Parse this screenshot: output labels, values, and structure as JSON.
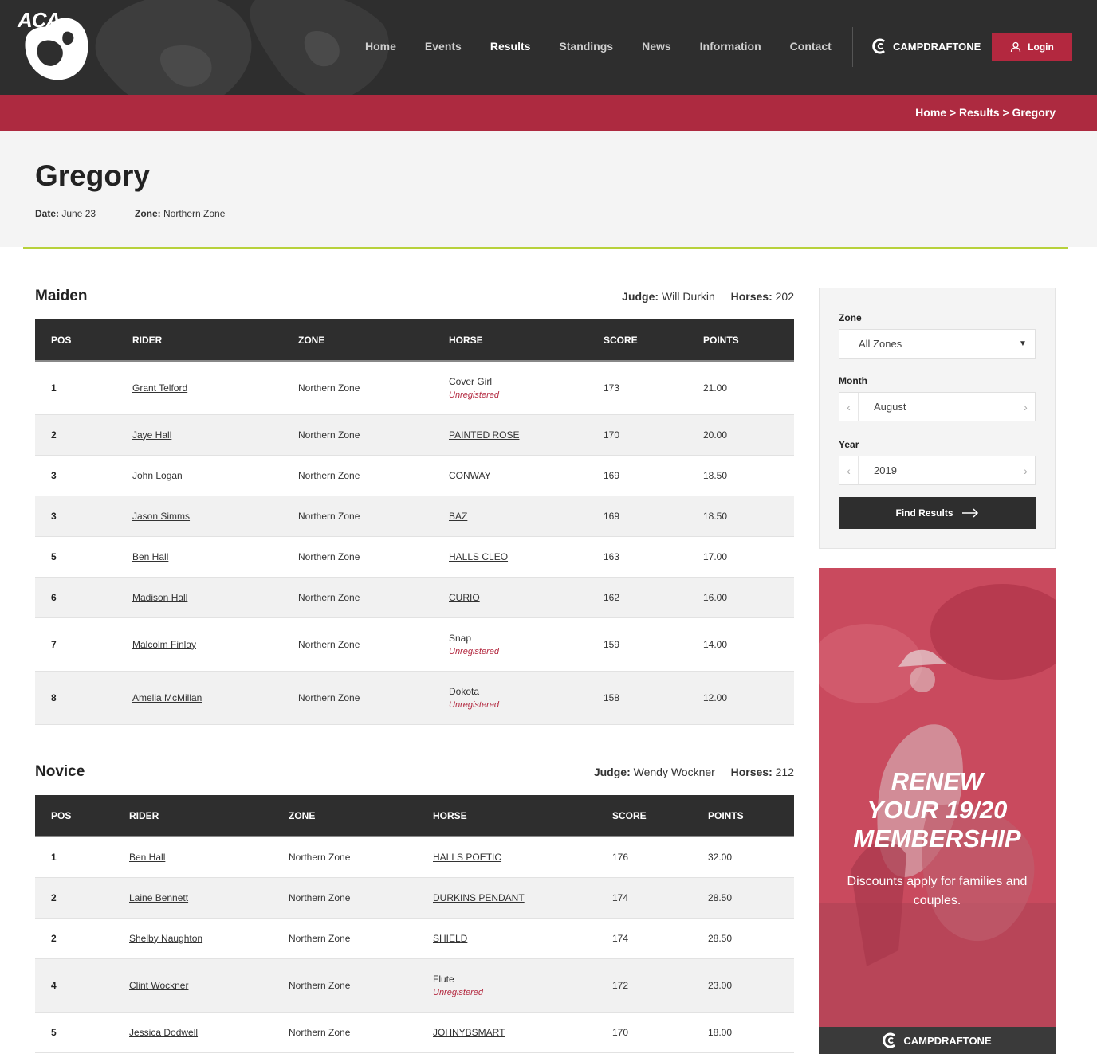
{
  "header": {
    "logo_text": "ACA",
    "nav": [
      {
        "label": "Home",
        "active": false
      },
      {
        "label": "Events",
        "active": false
      },
      {
        "label": "Results",
        "active": true
      },
      {
        "label": "Standings",
        "active": false
      },
      {
        "label": "News",
        "active": false
      },
      {
        "label": "Information",
        "active": false
      },
      {
        "label": "Contact",
        "active": false
      }
    ],
    "brand": "CAMPDRAFTONE",
    "login_label": "Login"
  },
  "breadcrumb": "Home > Results > Gregory",
  "page": {
    "title": "Gregory",
    "date_label": "Date:",
    "date_value": "June 23",
    "zone_label": "Zone:",
    "zone_value": "Northern Zone"
  },
  "sections": [
    {
      "title": "Maiden",
      "judge_label": "Judge:",
      "judge": "Will Durkin",
      "horses_label": "Horses:",
      "horses": "202",
      "columns": [
        "POS",
        "RIDER",
        "ZONE",
        "HORSE",
        "SCORE",
        "POINTS"
      ],
      "rows": [
        {
          "pos": "1",
          "rider": "Grant Telford",
          "zone": "Northern Zone",
          "horse": "Cover Girl",
          "unregistered": "Unregistered",
          "score": "173",
          "points": "21.00"
        },
        {
          "pos": "2",
          "rider": "Jaye Hall",
          "zone": "Northern Zone",
          "horse": "PAINTED ROSE",
          "score": "170",
          "points": "20.00"
        },
        {
          "pos": "3",
          "rider": "John Logan",
          "zone": "Northern Zone",
          "horse": "CONWAY",
          "score": "169",
          "points": "18.50"
        },
        {
          "pos": "3",
          "rider": "Jason Simms",
          "zone": "Northern Zone",
          "horse": "BAZ",
          "score": "169",
          "points": "18.50"
        },
        {
          "pos": "5",
          "rider": "Ben Hall",
          "zone": "Northern Zone",
          "horse": "HALLS CLEO",
          "score": "163",
          "points": "17.00"
        },
        {
          "pos": "6",
          "rider": "Madison Hall",
          "zone": "Northern Zone",
          "horse": "CURIO",
          "score": "162",
          "points": "16.00"
        },
        {
          "pos": "7",
          "rider": "Malcolm Finlay",
          "zone": "Northern Zone",
          "horse": "Snap",
          "unregistered": "Unregistered",
          "score": "159",
          "points": "14.00"
        },
        {
          "pos": "8",
          "rider": "Amelia McMillan",
          "zone": "Northern Zone",
          "horse": "Dokota",
          "unregistered": "Unregistered",
          "score": "158",
          "points": "12.00"
        }
      ]
    },
    {
      "title": "Novice",
      "judge_label": "Judge:",
      "judge": "Wendy Wockner",
      "horses_label": "Horses:",
      "horses": "212",
      "columns": [
        "POS",
        "RIDER",
        "ZONE",
        "HORSE",
        "SCORE",
        "POINTS"
      ],
      "rows": [
        {
          "pos": "1",
          "rider": "Ben Hall",
          "zone": "Northern Zone",
          "horse": "HALLS POETIC",
          "score": "176",
          "points": "32.00"
        },
        {
          "pos": "2",
          "rider": "Laine Bennett",
          "zone": "Northern Zone",
          "horse": "DURKINS PENDANT",
          "score": "174",
          "points": "28.50"
        },
        {
          "pos": "2",
          "rider": "Shelby Naughton",
          "zone": "Northern Zone",
          "horse": "SHIELD",
          "score": "174",
          "points": "28.50"
        },
        {
          "pos": "4",
          "rider": "Clint Wockner",
          "zone": "Northern Zone",
          "horse": "Flute",
          "unregistered": "Unregistered",
          "score": "172",
          "points": "23.00"
        },
        {
          "pos": "5",
          "rider": "Jessica Dodwell",
          "zone": "Northern Zone",
          "horse": "JOHNYBSMART",
          "score": "170",
          "points": "18.00"
        }
      ]
    }
  ],
  "filter": {
    "zone_label": "Zone",
    "zone_value": "All Zones",
    "month_label": "Month",
    "month_value": "August",
    "year_label": "Year",
    "year_value": "2019",
    "button_label": "Find Results"
  },
  "promo": {
    "title_line1": "RENEW",
    "title_line2": "YOUR 19/20",
    "title_line3": "MEMBERSHIP",
    "subtitle": "Discounts apply for families and couples.",
    "footer_brand": "CAMPDRAFTONE"
  },
  "colors": {
    "header_bg": "#2e2e2e",
    "accent_red": "#ad2a40",
    "accent_green": "#b7d13b"
  }
}
